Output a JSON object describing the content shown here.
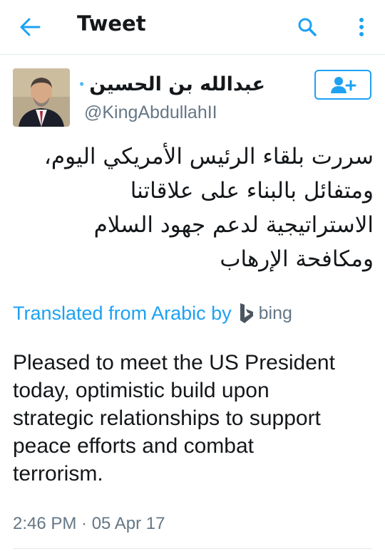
{
  "appbar": {
    "title": "Tweet",
    "back_icon": "arrow-left-icon",
    "search_icon": "search-icon",
    "more_icon": "more-vertical-icon"
  },
  "author": {
    "display_name": "عبدالله بن الحسين",
    "handle": "@KingAbdullahII",
    "verified": true,
    "follow_icon": "follow-user-icon"
  },
  "tweet": {
    "arabic_lines": [
      "سررت بلقاء الرئيس الأمريكي اليوم،",
      "ومتفائل بالبناء على علاقاتنا",
      "الاستراتيجية لدعم جهود السلام",
      "ومكافحة الإرهاب"
    ],
    "translated_label": "Translated from Arabic by",
    "translator_name": "bing",
    "english_lines": [
      "Pleased to meet the US President",
      "today, optimistic build upon",
      "strategic relationships to support",
      "peace efforts and combat",
      "terrorism."
    ],
    "timestamp": "2:46 PM · 05 Apr 17"
  },
  "colors": {
    "accent": "#1da1f2",
    "text": "#14171a",
    "secondary": "#657786",
    "divider": "#e1e8ed"
  }
}
